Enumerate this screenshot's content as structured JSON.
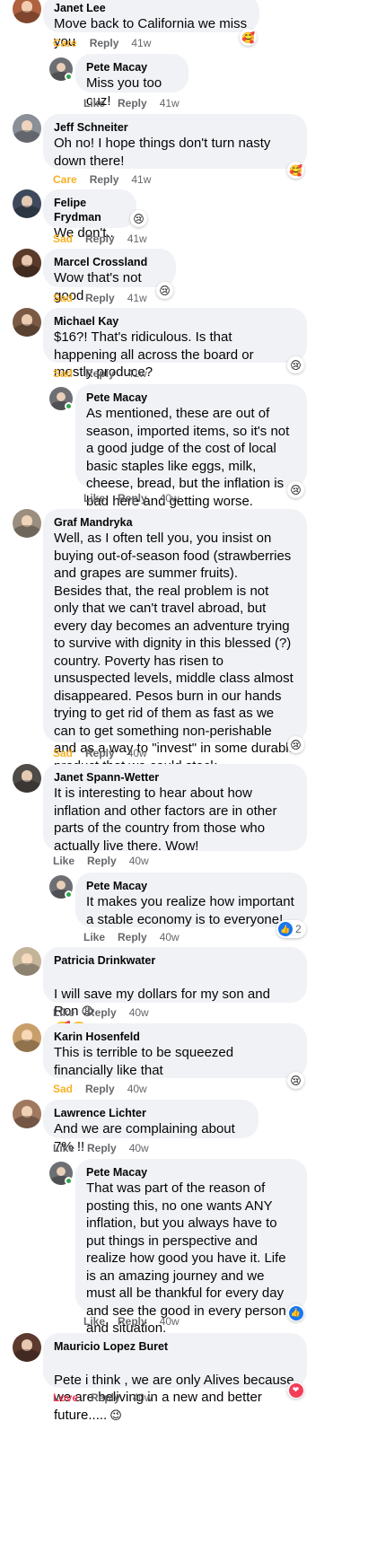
{
  "comments": [
    {
      "author": "Janet Lee",
      "text": "Move back to California we miss you",
      "reaction_label": "Care",
      "reply": "Reply",
      "time": "41w"
    },
    {
      "author": "Pete Macay",
      "text": "Miss you too cuz!",
      "like": "Like",
      "reply": "Reply",
      "time": "41w"
    },
    {
      "author": "Jeff Schneiter",
      "text": "Oh no! I hope things don't turn nasty down there!",
      "reaction_label": "Care",
      "reply": "Reply",
      "time": "41w"
    },
    {
      "author": "Felipe Frydman",
      "text": "We don't..",
      "reaction_label": "Sad",
      "reply": "Reply",
      "time": "41w"
    },
    {
      "author": "Marcel Crossland",
      "text": "Wow that's not good",
      "reaction_label": "Sad",
      "reply": "Reply",
      "time": "41w"
    },
    {
      "author": "Michael Kay",
      "text": "$16?! That's ridiculous. Is that happening all across the board or mostly produce?",
      "reaction_label": "Sad",
      "reply": "Reply",
      "time": "41w"
    },
    {
      "author": "Pete Macay",
      "text": "As mentioned, these are out of season, imported items, so it's not a good judge of the cost of local basic staples like eggs, milk, cheese, bread, but the inflation is bad here and getting worse.",
      "like": "Like",
      "reply": "Reply",
      "time": "40w"
    },
    {
      "author": "Graf Mandryka",
      "text": "Well, as I often tell you, you insist on buying out-of-season food (strawberries and grapes are summer fruits).\nBesides that, the real problem is not only that we can't travel abroad, but every day becomes an adventure trying to survive with dignity in this blessed (?) country. Poverty has risen to unsuspected levels, middle class almost disappeared. Pesos burn in our hands trying to get rid of them as fast as we can to get something non-perishable and as a way to \"invest\" in some durable product that we could stock.",
      "reaction_label": "Sad",
      "reply": "Reply",
      "time": "40w"
    },
    {
      "author": "Janet Spann-Wetter",
      "text": "It is interesting to hear about how inflation and other factors are in other parts of the country from those who actually live there. Wow!",
      "like": "Like",
      "reply": "Reply",
      "time": "40w"
    },
    {
      "author": "Pete Macay",
      "text": "It makes you realize how important a stable economy is to everyone!",
      "like": "Like",
      "reply": "Reply",
      "time": "40w",
      "reaction_count": "2"
    },
    {
      "author": "Patricia Drinkwater",
      "text": "I will save my dollars for my son and Ron",
      "like": "Like",
      "reply": "Reply",
      "time": "40w"
    },
    {
      "author": "Karin Hosenfeld",
      "text": "This is terrible to be squeezed financially like that",
      "reaction_label": "Sad",
      "reply": "Reply",
      "time": "40w"
    },
    {
      "author": "Lawrence Lichter",
      "text": "And we are complaining about 7% !!",
      "like": "Like",
      "reply": "Reply",
      "time": "40w"
    },
    {
      "author": "Pete Macay",
      "text": "That was part of the reason of posting this, no one wants ANY inflation, but you always have to put things in perspective and realize how good you have it. Life is an amazing journey and we must all be thankful for every day and see the good in every person and situation.",
      "like": "Like",
      "reply": "Reply",
      "time": "40w"
    },
    {
      "author": "Mauricio Lopez Buret",
      "text": "Pete i think , we are only Alives because we are beliving in a new and better future.....",
      "reaction_label": "Love",
      "reply": "Reply",
      "time": "40w"
    }
  ],
  "colors": {
    "bubble": "#f0f2f5",
    "meta_text": "#65676b",
    "care": "#f7b125",
    "sad": "#f7b125",
    "love": "#f33e58",
    "like_blue": "#1877f2",
    "online_green": "#31a24c"
  },
  "icons": {
    "care": "care-reaction-icon",
    "sad": "sad-reaction-icon",
    "like": "like-reaction-icon",
    "love": "love-reaction-icon",
    "heart_eyes": "heart-eyes-emoji",
    "zany": "zany-face-emoji"
  }
}
